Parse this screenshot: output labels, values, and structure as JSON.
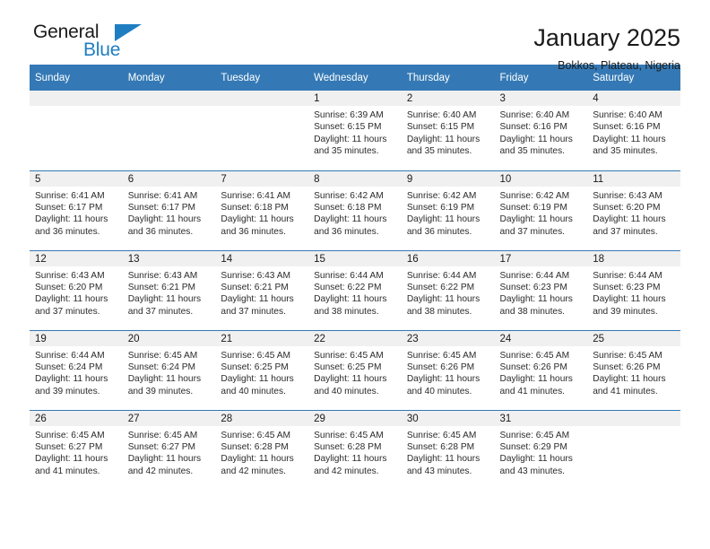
{
  "brand": {
    "name_part1": "General",
    "name_part2": "Blue",
    "triangle_icon": "triangle-icon",
    "accent_color": "#1f7ec2"
  },
  "header": {
    "title": "January 2025",
    "subtitle": "Bokkos, Plateau, Nigeria"
  },
  "calendar": {
    "header_bg": "#3479b5",
    "daynum_bg": "#f0f0f0",
    "weekdays": [
      "Sunday",
      "Monday",
      "Tuesday",
      "Wednesday",
      "Thursday",
      "Friday",
      "Saturday"
    ],
    "weeks": [
      [
        {
          "day": "",
          "lines": []
        },
        {
          "day": "",
          "lines": []
        },
        {
          "day": "",
          "lines": []
        },
        {
          "day": "1",
          "lines": [
            "Sunrise: 6:39 AM",
            "Sunset: 6:15 PM",
            "Daylight: 11 hours",
            "and 35 minutes."
          ]
        },
        {
          "day": "2",
          "lines": [
            "Sunrise: 6:40 AM",
            "Sunset: 6:15 PM",
            "Daylight: 11 hours",
            "and 35 minutes."
          ]
        },
        {
          "day": "3",
          "lines": [
            "Sunrise: 6:40 AM",
            "Sunset: 6:16 PM",
            "Daylight: 11 hours",
            "and 35 minutes."
          ]
        },
        {
          "day": "4",
          "lines": [
            "Sunrise: 6:40 AM",
            "Sunset: 6:16 PM",
            "Daylight: 11 hours",
            "and 35 minutes."
          ]
        }
      ],
      [
        {
          "day": "5",
          "lines": [
            "Sunrise: 6:41 AM",
            "Sunset: 6:17 PM",
            "Daylight: 11 hours",
            "and 36 minutes."
          ]
        },
        {
          "day": "6",
          "lines": [
            "Sunrise: 6:41 AM",
            "Sunset: 6:17 PM",
            "Daylight: 11 hours",
            "and 36 minutes."
          ]
        },
        {
          "day": "7",
          "lines": [
            "Sunrise: 6:41 AM",
            "Sunset: 6:18 PM",
            "Daylight: 11 hours",
            "and 36 minutes."
          ]
        },
        {
          "day": "8",
          "lines": [
            "Sunrise: 6:42 AM",
            "Sunset: 6:18 PM",
            "Daylight: 11 hours",
            "and 36 minutes."
          ]
        },
        {
          "day": "9",
          "lines": [
            "Sunrise: 6:42 AM",
            "Sunset: 6:19 PM",
            "Daylight: 11 hours",
            "and 36 minutes."
          ]
        },
        {
          "day": "10",
          "lines": [
            "Sunrise: 6:42 AM",
            "Sunset: 6:19 PM",
            "Daylight: 11 hours",
            "and 37 minutes."
          ]
        },
        {
          "day": "11",
          "lines": [
            "Sunrise: 6:43 AM",
            "Sunset: 6:20 PM",
            "Daylight: 11 hours",
            "and 37 minutes."
          ]
        }
      ],
      [
        {
          "day": "12",
          "lines": [
            "Sunrise: 6:43 AM",
            "Sunset: 6:20 PM",
            "Daylight: 11 hours",
            "and 37 minutes."
          ]
        },
        {
          "day": "13",
          "lines": [
            "Sunrise: 6:43 AM",
            "Sunset: 6:21 PM",
            "Daylight: 11 hours",
            "and 37 minutes."
          ]
        },
        {
          "day": "14",
          "lines": [
            "Sunrise: 6:43 AM",
            "Sunset: 6:21 PM",
            "Daylight: 11 hours",
            "and 37 minutes."
          ]
        },
        {
          "day": "15",
          "lines": [
            "Sunrise: 6:44 AM",
            "Sunset: 6:22 PM",
            "Daylight: 11 hours",
            "and 38 minutes."
          ]
        },
        {
          "day": "16",
          "lines": [
            "Sunrise: 6:44 AM",
            "Sunset: 6:22 PM",
            "Daylight: 11 hours",
            "and 38 minutes."
          ]
        },
        {
          "day": "17",
          "lines": [
            "Sunrise: 6:44 AM",
            "Sunset: 6:23 PM",
            "Daylight: 11 hours",
            "and 38 minutes."
          ]
        },
        {
          "day": "18",
          "lines": [
            "Sunrise: 6:44 AM",
            "Sunset: 6:23 PM",
            "Daylight: 11 hours",
            "and 39 minutes."
          ]
        }
      ],
      [
        {
          "day": "19",
          "lines": [
            "Sunrise: 6:44 AM",
            "Sunset: 6:24 PM",
            "Daylight: 11 hours",
            "and 39 minutes."
          ]
        },
        {
          "day": "20",
          "lines": [
            "Sunrise: 6:45 AM",
            "Sunset: 6:24 PM",
            "Daylight: 11 hours",
            "and 39 minutes."
          ]
        },
        {
          "day": "21",
          "lines": [
            "Sunrise: 6:45 AM",
            "Sunset: 6:25 PM",
            "Daylight: 11 hours",
            "and 40 minutes."
          ]
        },
        {
          "day": "22",
          "lines": [
            "Sunrise: 6:45 AM",
            "Sunset: 6:25 PM",
            "Daylight: 11 hours",
            "and 40 minutes."
          ]
        },
        {
          "day": "23",
          "lines": [
            "Sunrise: 6:45 AM",
            "Sunset: 6:26 PM",
            "Daylight: 11 hours",
            "and 40 minutes."
          ]
        },
        {
          "day": "24",
          "lines": [
            "Sunrise: 6:45 AM",
            "Sunset: 6:26 PM",
            "Daylight: 11 hours",
            "and 41 minutes."
          ]
        },
        {
          "day": "25",
          "lines": [
            "Sunrise: 6:45 AM",
            "Sunset: 6:26 PM",
            "Daylight: 11 hours",
            "and 41 minutes."
          ]
        }
      ],
      [
        {
          "day": "26",
          "lines": [
            "Sunrise: 6:45 AM",
            "Sunset: 6:27 PM",
            "Daylight: 11 hours",
            "and 41 minutes."
          ]
        },
        {
          "day": "27",
          "lines": [
            "Sunrise: 6:45 AM",
            "Sunset: 6:27 PM",
            "Daylight: 11 hours",
            "and 42 minutes."
          ]
        },
        {
          "day": "28",
          "lines": [
            "Sunrise: 6:45 AM",
            "Sunset: 6:28 PM",
            "Daylight: 11 hours",
            "and 42 minutes."
          ]
        },
        {
          "day": "29",
          "lines": [
            "Sunrise: 6:45 AM",
            "Sunset: 6:28 PM",
            "Daylight: 11 hours",
            "and 42 minutes."
          ]
        },
        {
          "day": "30",
          "lines": [
            "Sunrise: 6:45 AM",
            "Sunset: 6:28 PM",
            "Daylight: 11 hours",
            "and 43 minutes."
          ]
        },
        {
          "day": "31",
          "lines": [
            "Sunrise: 6:45 AM",
            "Sunset: 6:29 PM",
            "Daylight: 11 hours",
            "and 43 minutes."
          ]
        },
        {
          "day": "",
          "lines": []
        }
      ]
    ]
  }
}
